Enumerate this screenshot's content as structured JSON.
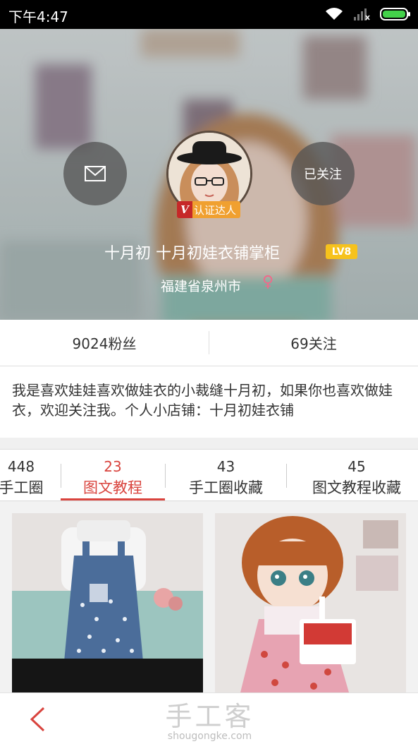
{
  "status_bar": {
    "time": "下午4:47"
  },
  "profile": {
    "message_icon": "mail-icon",
    "follow_label": "已关注",
    "verified_badge_mark": "V",
    "verified_badge_text": "认证达人",
    "name": "十月初 十月初娃衣铺掌柜",
    "level": "LV8",
    "location": "福建省泉州市",
    "gender_symbol": "♀"
  },
  "stats": {
    "fans": "9024粉丝",
    "following": "69关注"
  },
  "bio": "我是喜欢娃娃喜欢做娃衣的小裁缝十月初，如果你也喜欢做娃衣，欢迎关注我。个人小店铺：十月初娃衣铺",
  "tabs": [
    {
      "count": "448",
      "label": "手工圈"
    },
    {
      "count": "23",
      "label": "图文教程"
    },
    {
      "count": "43",
      "label": "手工圈收藏"
    },
    {
      "count": "45",
      "label": "图文教程收藏"
    }
  ],
  "bottom": {
    "watermark_cn": "手工客",
    "watermark_en": "shougongke.com"
  },
  "colors": {
    "accent": "#d9443e",
    "level_badge": "#f6c21c",
    "verified_red": "#c62828",
    "verified_orange": "#f0a030",
    "female": "#f06a8a"
  }
}
